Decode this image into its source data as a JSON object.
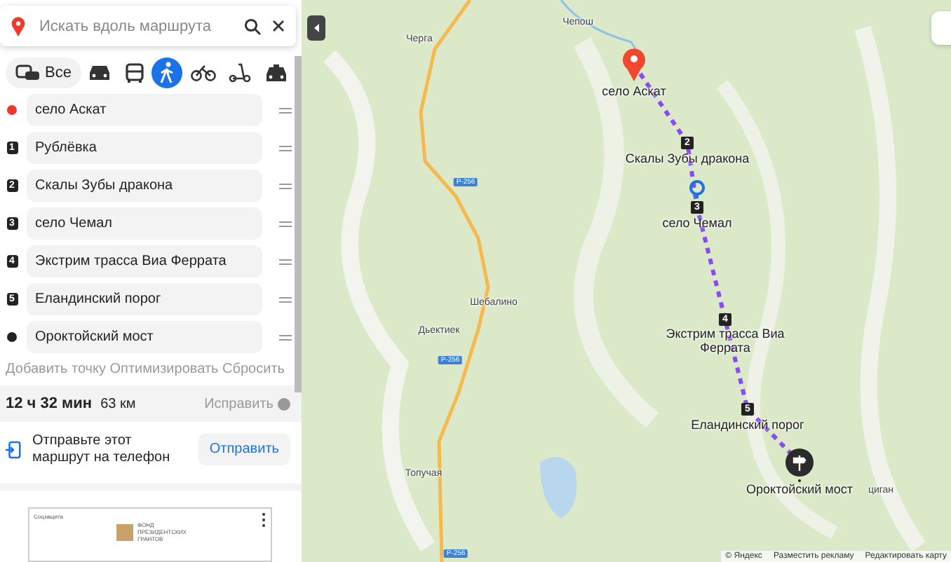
{
  "search": {
    "placeholder": "Искать вдоль маршрута"
  },
  "modes": [
    {
      "kind": "all",
      "label": "Все",
      "selected": false
    },
    {
      "kind": "car",
      "selected": false
    },
    {
      "kind": "bus",
      "selected": false
    },
    {
      "kind": "walk",
      "selected": true
    },
    {
      "kind": "bike",
      "selected": false
    },
    {
      "kind": "scooter",
      "selected": false
    },
    {
      "kind": "taxi",
      "selected": false
    }
  ],
  "waypoints": [
    {
      "kind": "start",
      "value": "село Аскат"
    },
    {
      "kind": "number",
      "number": "1",
      "value": "Рублёвка"
    },
    {
      "kind": "number",
      "number": "2",
      "value": "Скалы Зубы дракона"
    },
    {
      "kind": "number",
      "number": "3",
      "value": "село Чемал"
    },
    {
      "kind": "number",
      "number": "4",
      "value": "Экстрим трасса Виа Феррата"
    },
    {
      "kind": "number",
      "number": "5",
      "value": "Еландинский порог"
    },
    {
      "kind": "end",
      "value": "Ороктойский мост"
    }
  ],
  "actions": [
    "Добавить точку",
    "Оптимизировать",
    "Сбросить"
  ],
  "summary": {
    "time": "12 ч 32 мин",
    "distance": "63 км",
    "fix": "Исправить"
  },
  "send": {
    "text": "Отправьте этот маршрут на телефон",
    "button": "Отправить"
  },
  "ad": {
    "caption": "Соцзащита",
    "logo_text": "ФОНД ПРЕЗИДЕНТСКИХ ГРАНТОВ"
  },
  "map": {
    "places": [
      "Черга",
      "Чепош",
      "Шебалино",
      "Дьектиек",
      "Топучая",
      "циган"
    ],
    "road_signs": [
      "Р-256",
      "Р-256",
      "Р-256"
    ],
    "stops": [
      {
        "kind": "start",
        "label": "село Аскат"
      },
      {
        "kind": "number",
        "number": "2",
        "label": "Скалы Зубы дракона"
      },
      {
        "kind": "number",
        "number": "3",
        "label": "село Чемал"
      },
      {
        "kind": "number",
        "number": "4",
        "label": "Экстрим трасса Виа Феррата"
      },
      {
        "kind": "number",
        "number": "5",
        "label": "Еландинский порог"
      },
      {
        "kind": "end",
        "label": "Ороктойский мост"
      }
    ],
    "footer": [
      "© Яндекс",
      "Разместить рекламу",
      "Редактировать карту"
    ]
  }
}
